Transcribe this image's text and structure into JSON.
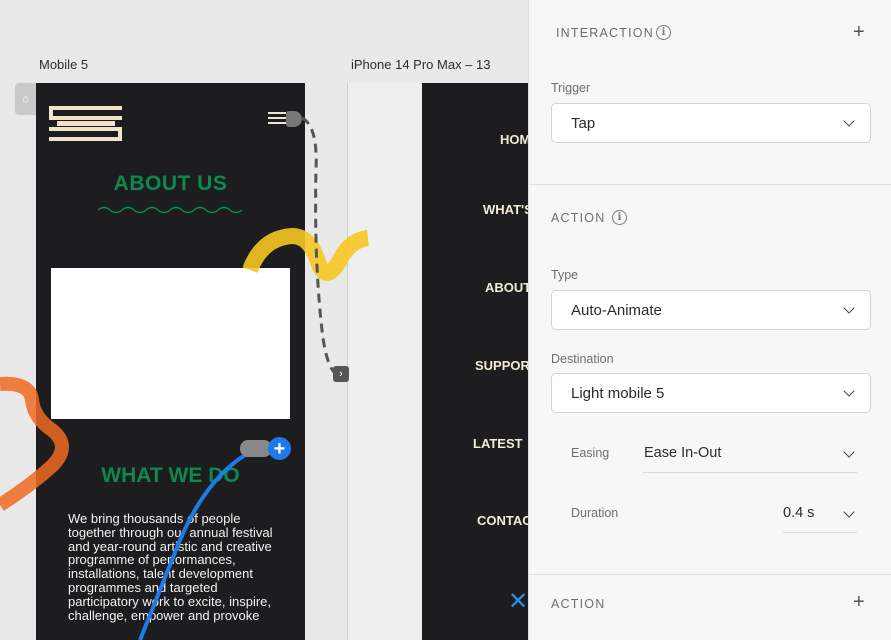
{
  "canvas": {
    "artboards": [
      {
        "label": "Mobile 5"
      },
      {
        "label": "iPhone 14 Pro Max – 13"
      }
    ],
    "mobile5": {
      "about_title": "ABOUT US",
      "what_title": "WHAT WE DO",
      "body_text": "We bring thousands of people together through our annual festival and year-round artistic and creative programme of performances, installations, talent development programmes and targeted participatory work to excite, inspire, challenge, empower and provoke"
    },
    "iphone_menu": [
      "HOM",
      "WHAT'S",
      "ABOUT",
      "SUPPOR",
      "LATEST",
      "CONTAC"
    ]
  },
  "panel": {
    "interaction": {
      "title": "INTERACTION",
      "trigger_label": "Trigger",
      "trigger_value": "Tap"
    },
    "action": {
      "title": "ACTION",
      "type_label": "Type",
      "type_value": "Auto-Animate",
      "destination_label": "Destination",
      "destination_value": "Light mobile 5",
      "easing_label": "Easing",
      "easing_value": "Ease In-Out",
      "duration_label": "Duration",
      "duration_value": "0.4 s"
    },
    "action2": {
      "title": "ACTION"
    }
  },
  "colors": {
    "accent_green": "#0c8a4e",
    "link_blue": "#1d7ae8",
    "dark_board": "#1d1d1f"
  }
}
